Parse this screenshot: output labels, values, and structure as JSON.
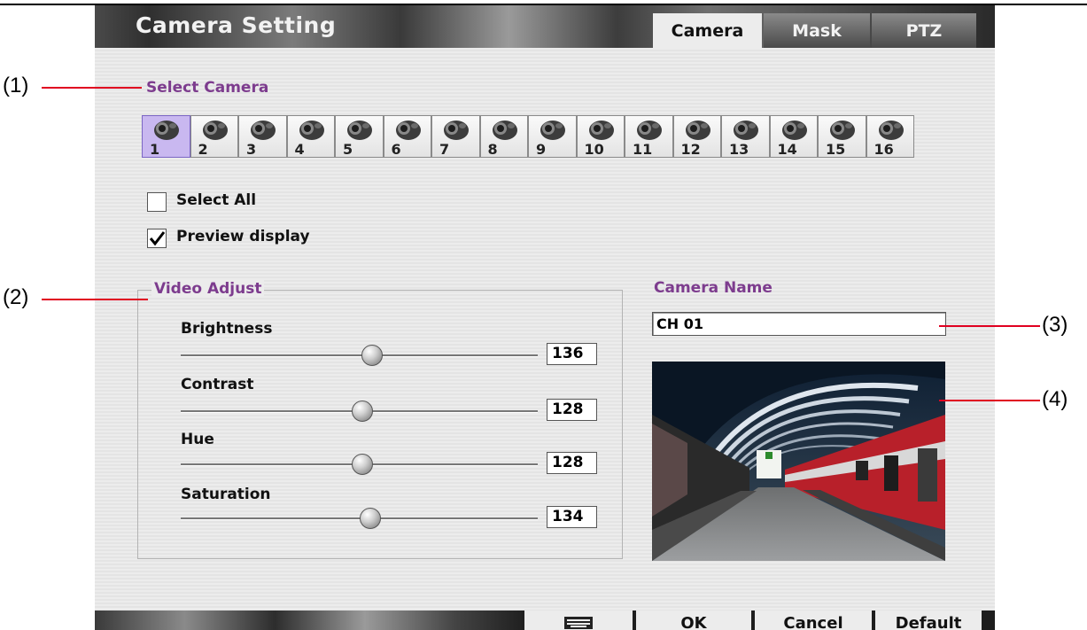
{
  "window": {
    "title": "Camera Setting"
  },
  "tabs": [
    {
      "label": "Camera",
      "active": true
    },
    {
      "label": "Mask",
      "active": false
    },
    {
      "label": "PTZ",
      "active": false
    }
  ],
  "select_camera": {
    "label": "Select Camera",
    "cameras": [
      "1",
      "2",
      "3",
      "4",
      "5",
      "6",
      "7",
      "8",
      "9",
      "10",
      "11",
      "12",
      "13",
      "14",
      "15",
      "16"
    ],
    "selected": "1"
  },
  "options": {
    "select_all": {
      "label": "Select All",
      "checked": false
    },
    "preview_display": {
      "label": "Preview display",
      "checked": true
    }
  },
  "video_adjust": {
    "label": "Video Adjust",
    "sliders": [
      {
        "label": "Brightness",
        "value": "136"
      },
      {
        "label": "Contrast",
        "value": "128"
      },
      {
        "label": "Hue",
        "value": "128"
      },
      {
        "label": "Saturation",
        "value": "134"
      }
    ]
  },
  "camera_name": {
    "label": "Camera Name",
    "value": "CH 01"
  },
  "buttons": {
    "ok": "OK",
    "cancel": "Cancel",
    "default": "Default"
  },
  "icons": {
    "keyboard": "keyboard-icon",
    "camera": "camera-icon",
    "checkmark": "checkmark-icon"
  },
  "callouts": [
    "(1)",
    "(2)",
    "(3)",
    "(4)"
  ],
  "colors": {
    "section_label": "#7d3c8e",
    "callout_line": "#e00020",
    "selected_camera": "#c9b8f0"
  }
}
